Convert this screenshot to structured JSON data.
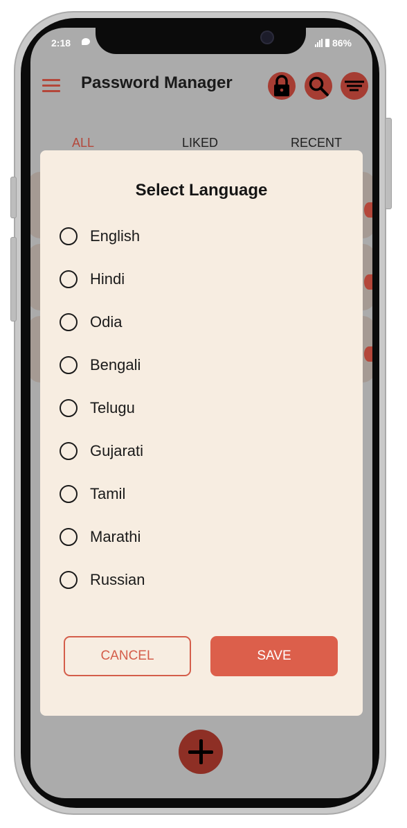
{
  "status_bar": {
    "time": "2:18",
    "battery": "86%"
  },
  "app_bar": {
    "title": "Password Manager",
    "menu_icon": "hamburger-menu-icon",
    "lock_icon": "lock-icon",
    "search_icon": "search-icon",
    "filter_icon": "filter-icon"
  },
  "tabs": [
    {
      "label": "ALL"
    },
    {
      "label": "LIKED"
    },
    {
      "label": "RECENT"
    }
  ],
  "dialog": {
    "title": "Select Language",
    "options": [
      {
        "label": "English"
      },
      {
        "label": "Hindi"
      },
      {
        "label": "Odia"
      },
      {
        "label": "Bengali"
      },
      {
        "label": "Telugu"
      },
      {
        "label": "Gujarati"
      },
      {
        "label": "Tamil"
      },
      {
        "label": "Marathi"
      },
      {
        "label": "Russian"
      }
    ],
    "cancel_label": "CANCEL",
    "save_label": "SAVE"
  },
  "fab": {
    "icon": "plus-icon"
  },
  "colors": {
    "accent": "#dc5f4b",
    "dark_accent": "#a63d33",
    "dialog_bg": "#f7ede1",
    "scrim": "#ababab"
  }
}
